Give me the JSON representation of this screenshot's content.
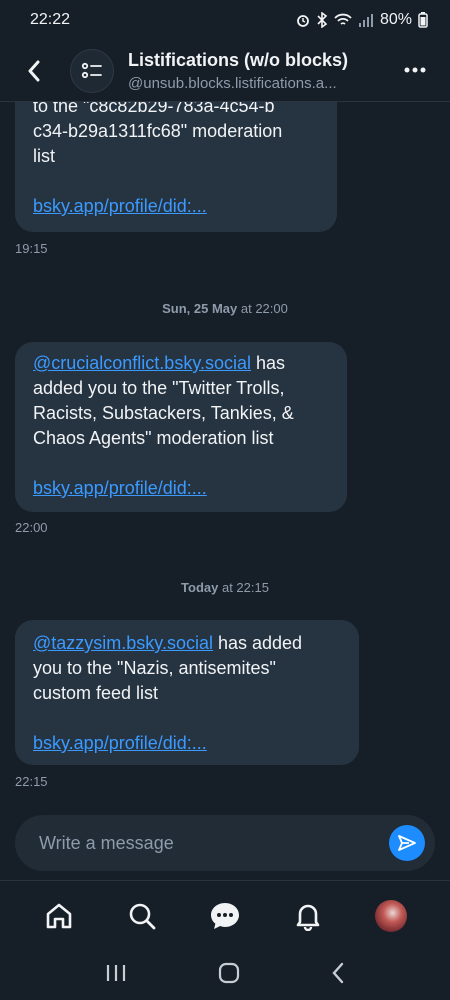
{
  "status": {
    "time": "22:22",
    "battery": "80%"
  },
  "header": {
    "title": "Listifications (w/o blocks)",
    "handle": "@unsub.blocks.listifications.a..."
  },
  "messages": [
    {
      "line1": "to the \"c8c82b29-783a-4c54-b",
      "line2": "c34-b29a1311fc68\" moderation",
      "line3": "list",
      "link": "bsky.app/profile/did:...",
      "time": "19:15"
    },
    {
      "date_bold": "Sun, 25 May",
      "date_rest": " at 22:00",
      "mention": "@crucialconflict.bsky.social",
      "after_mention": " has",
      "line2": "added you to the \"Twitter Trolls,",
      "line3": "Racists, Substackers, Tankies, &",
      "line4": "Chaos Agents\" moderation list",
      "link": "bsky.app/profile/did:...",
      "time": "22:00"
    },
    {
      "date_bold": "Today",
      "date_rest": " at 22:15",
      "mention": "@tazzysim.bsky.social",
      "after_mention": " has added",
      "line2": "you to the \"Nazis, antisemites\"",
      "line3": "custom feed list",
      "link": "bsky.app/profile/did:...",
      "time": "22:15"
    }
  ],
  "composer": {
    "placeholder": "Write a message"
  },
  "tabs": [
    "home-icon",
    "search-icon",
    "chat-icon",
    "bell-icon",
    "profile-avatar"
  ],
  "colors": {
    "background": "#161e27",
    "bubble": "#263442",
    "link": "#3b9aff",
    "send": "#1d8cff"
  }
}
